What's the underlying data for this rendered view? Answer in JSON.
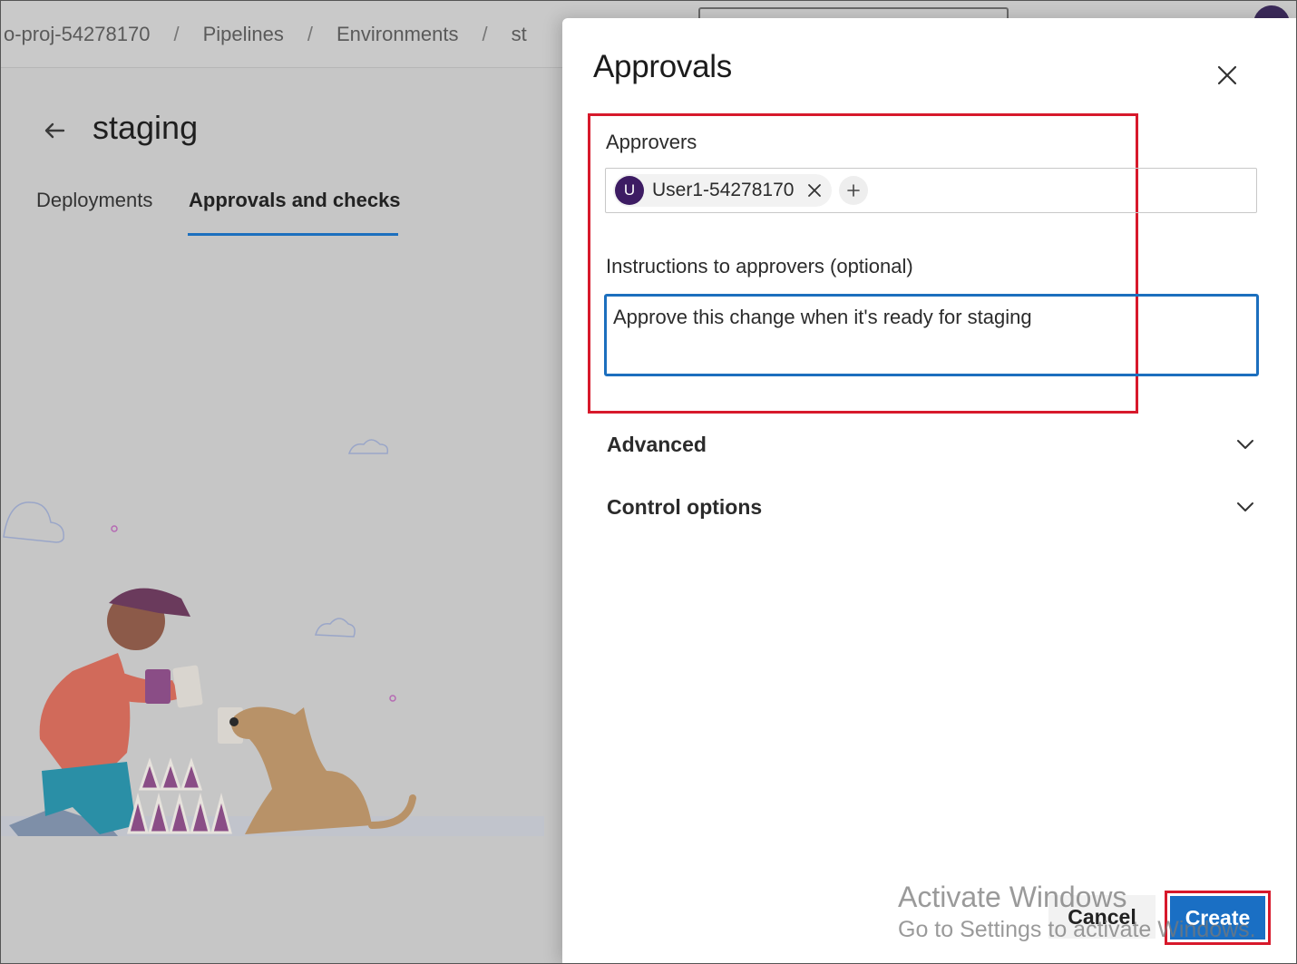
{
  "breadcrumb": [
    "o-proj-54278170",
    "Pipelines",
    "Environments",
    "st"
  ],
  "page": {
    "title": "staging",
    "tabs": [
      {
        "label": "Deployments",
        "active": false
      },
      {
        "label": "Approvals and checks",
        "active": true
      }
    ]
  },
  "panel": {
    "title": "Approvals",
    "approvers_label": "Approvers",
    "approvers": [
      {
        "initial": "U",
        "name": "User1-54278170"
      }
    ],
    "instructions_label": "Instructions to approvers (optional)",
    "instructions_value": "Approve this change when it's ready for staging",
    "sections": [
      {
        "label": "Advanced"
      },
      {
        "label": "Control options"
      }
    ],
    "cancel_label": "Cancel",
    "create_label": "Create"
  },
  "watermark": {
    "title": "Activate Windows",
    "subtitle": "Go to Settings to activate Windows."
  },
  "colors": {
    "accent": "#1a6fc4",
    "highlight": "#d7192b",
    "avatar": "#3d1c63"
  },
  "icons": [
    "back-arrow-icon",
    "close-icon",
    "remove-icon",
    "add-icon",
    "chevron-down-icon"
  ]
}
